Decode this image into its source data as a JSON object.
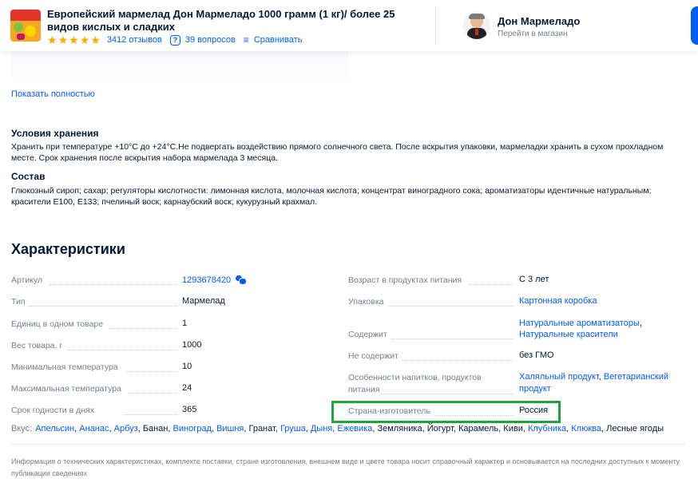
{
  "header": {
    "product_title": "Европейский мармелад Дон Мармеладо 1000 грамм (1 кг)/ более 25 видов кислых и сладких",
    "reviews": "3412 отзывов",
    "questions": "39 вопросов",
    "compare": "Сравнивать",
    "rating_stars": 5,
    "shop_name": "Дон Мармеладо",
    "shop_link": "Перейти в магазин"
  },
  "description": {
    "show_more": "Показать полностью",
    "storage_title": "Условия хранения",
    "storage_text": "Хранить при температуре +10°C до +24°C.Не подвергать воздействию прямого солнечного света. После вскрытия упаковки, мармеладки хранить в сухом прохладном месте. Срок хранения после вскрытия набора мармелада 3 месяца.",
    "composition_title": "Состав",
    "composition_text": "Глюкозный сироп; сахар; регуляторы кислотности: лимонная кислота, молочная кислота; концентрат виноградного сока; ароматизаторы идентичные натуральным; красители E100, E133; пчелиный воск; карнаубский воск; кукурузный крахмал."
  },
  "characteristics": {
    "title": "Характеристики",
    "left": [
      {
        "label": "Артикул",
        "value": "1293678420",
        "link": true,
        "copy": true
      },
      {
        "label": "Тип",
        "value": "Мармелад"
      },
      {
        "label": "Единиц в одном товаре",
        "value": "1"
      },
      {
        "label": "Вес товара, г",
        "value": "1000"
      },
      {
        "label": "Минимальная температура",
        "value": "10"
      },
      {
        "label": "Максимальная температура",
        "value": "24"
      },
      {
        "label": "Срок годности в днях",
        "value": "365"
      }
    ],
    "right": [
      {
        "label": "Возраст в продуктах питания",
        "value": "С 3 лет"
      },
      {
        "label": "Упаковка",
        "value": "Картонная коробка"
      },
      {
        "label": "Содержит",
        "value_line1": "Натуральные ароматизаторы",
        "value_line1_suffix": ",",
        "value_line2": "Натуральные красители"
      },
      {
        "label": "Не содержит",
        "value": "без ГМО"
      },
      {
        "label_line1": "Особенности напитков, продуктов",
        "label_line2": "питания",
        "value_line1_a": "Халяльный продукт",
        "value_line1_sep": ", ",
        "value_line1_b": "Вегетарианский",
        "value_line2": "продукт"
      },
      {
        "label": "Страна-изготовитель",
        "value": "Россия"
      }
    ],
    "tastes_label": "Вкус:",
    "tastes": [
      {
        "t": "Апельсин",
        "link": true,
        "sep": ", "
      },
      {
        "t": "Ананас",
        "link": true,
        "sep": ", "
      },
      {
        "t": "Арбуз",
        "link": true,
        "sep": ", "
      },
      {
        "t": "Банан",
        "link": false,
        "sep": ", "
      },
      {
        "t": "Виноград",
        "link": true,
        "sep": ", "
      },
      {
        "t": "Вишня",
        "link": true,
        "sep": ", "
      },
      {
        "t": "Гранат",
        "link": false,
        "sep": ", "
      },
      {
        "t": "Груша",
        "link": true,
        "sep": ", "
      },
      {
        "t": "Дыня",
        "link": true,
        "sep": ", "
      },
      {
        "t": "Ежевика",
        "link": true,
        "sep": ", "
      },
      {
        "t": "Земляника",
        "link": false,
        "sep": ", "
      },
      {
        "t": "Йогурт",
        "link": false,
        "sep": ", "
      },
      {
        "t": "Карамель",
        "link": false,
        "sep": ", "
      },
      {
        "t": "Киви",
        "link": false,
        "sep": ", "
      },
      {
        "t": "Клубника",
        "link": true,
        "sep": ", "
      },
      {
        "t": "Клюква",
        "link": true,
        "sep": ", "
      },
      {
        "t": "Лесные ягоды",
        "link": false,
        "sep": ""
      }
    ]
  },
  "disclaimer": "Информация о технических характеристиках, комплекте поставки, стране изготовления, внешнем виде и цвете товара носит справочный характер и основывается на последних доступных к моменту публикации сведениях",
  "colors": {
    "link": "#005bff",
    "star": "#ffa800",
    "highlight": "#1ea43a",
    "muted": "#707f8d"
  }
}
